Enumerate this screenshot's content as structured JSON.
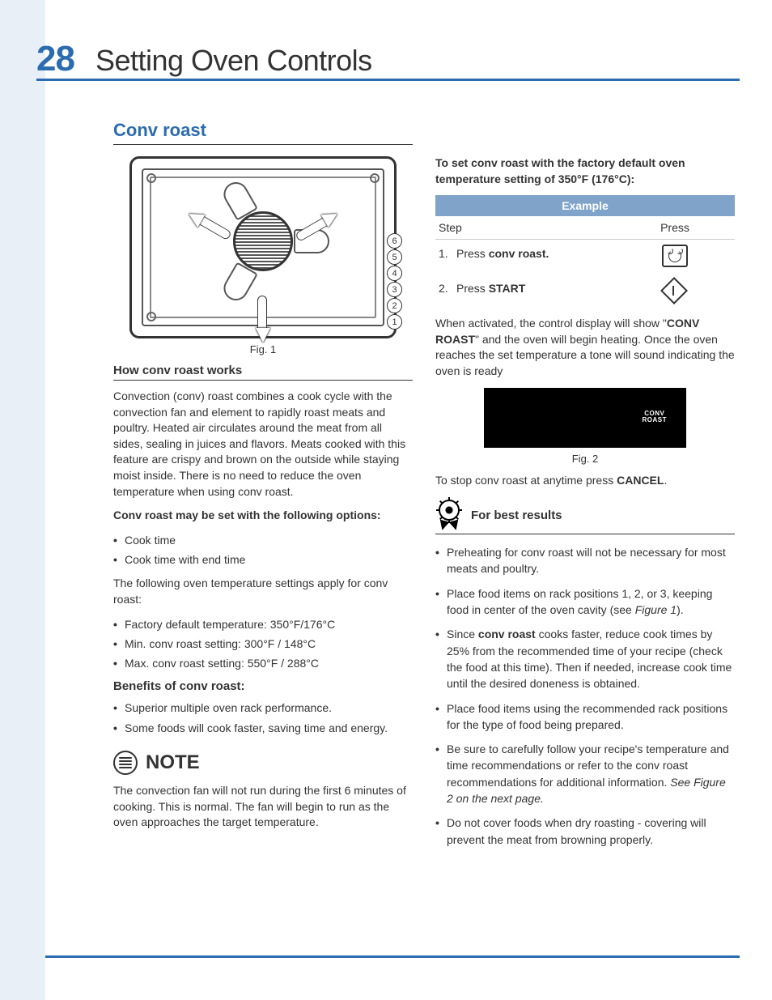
{
  "page_number": "28",
  "page_title": "Setting Oven Controls",
  "section_heading": "Conv roast",
  "fig1_caption": "Fig. 1",
  "rack_positions": [
    "6",
    "5",
    "4",
    "3",
    "2",
    "1"
  ],
  "how_works_heading": "How conv roast works",
  "how_works_p": "Convection (conv) roast combines a cook cycle with the convection fan and element to rapidly roast meats and poultry. Heated air circulates around the meat from all sides, sealing in juices and flavors. Meats cooked with this feature are crispy and brown on the outside while staying moist inside. There is no need to reduce the oven temperature when using conv roast.",
  "options_intro": "Conv roast may be set with the following options:",
  "options": [
    "Cook time",
    "Cook time with end time"
  ],
  "temps_intro": "The following oven temperature settings apply for conv roast:",
  "temps": [
    "Factory default temperature:  350°F/176°C",
    "Min. conv roast setting: 300°F / 148°C",
    "Max. conv roast setting: 550°F / 288°C"
  ],
  "benefits_heading": "Benefits of conv roast:",
  "benefits": [
    "Superior multiple oven rack performance.",
    "Some foods will cook faster, saving time and energy."
  ],
  "note_label": "NOTE",
  "note_body": "The convection fan will not run during the first 6 minutes of cooking. This is normal. The fan will begin to run as the oven approaches the target temperature.",
  "set_intro": "To set conv roast with the factory default oven temperature setting of 350°F (176°C):",
  "example_header": "Example",
  "col_step": "Step",
  "col_press": "Press",
  "steps": {
    "s1_pre": "Press ",
    "s1_bold": "conv roast.",
    "s2_pre": "Press ",
    "s2_bold": "START"
  },
  "activated_p": {
    "pre": "When activated, the control display will show \"",
    "bold1": "CONV ROAST",
    "post": "\" and the oven will begin heating. Once the oven reaches the set temperature a tone will sound indicating the oven is ready"
  },
  "display_label": "CONV\nROAST",
  "fig2_caption": "Fig. 2",
  "stop_p": {
    "pre": "To stop conv roast at anytime press ",
    "bold": "CANCEL",
    "post": "."
  },
  "best_results_heading": "For best results",
  "best_results_items": [
    {
      "text": "Preheating for conv roast will not be necessary for most meats and poultry."
    },
    {
      "pre": "Place food items on rack positions 1, 2, or 3, keeping food in center of the oven cavity (see ",
      "it": "Figure 1",
      "post": ")."
    },
    {
      "pre": "Since ",
      "bold": "conv roast",
      "post": " cooks faster, reduce cook times by 25% from the recommended time of your recipe (check the food at this time). Then if needed, increase cook time until the desired doneness is obtained."
    },
    {
      "text": "Place food items using the recommended rack positions for the type of food being prepared."
    },
    {
      "pre": "Be sure to carefully follow your recipe's temperature and time recommendations or refer to the conv roast recommendations for additional information. ",
      "it": "See Figure 2 on the next page."
    },
    {
      "text": "Do not cover foods when dry roasting - covering will prevent the meat from browning properly."
    }
  ]
}
